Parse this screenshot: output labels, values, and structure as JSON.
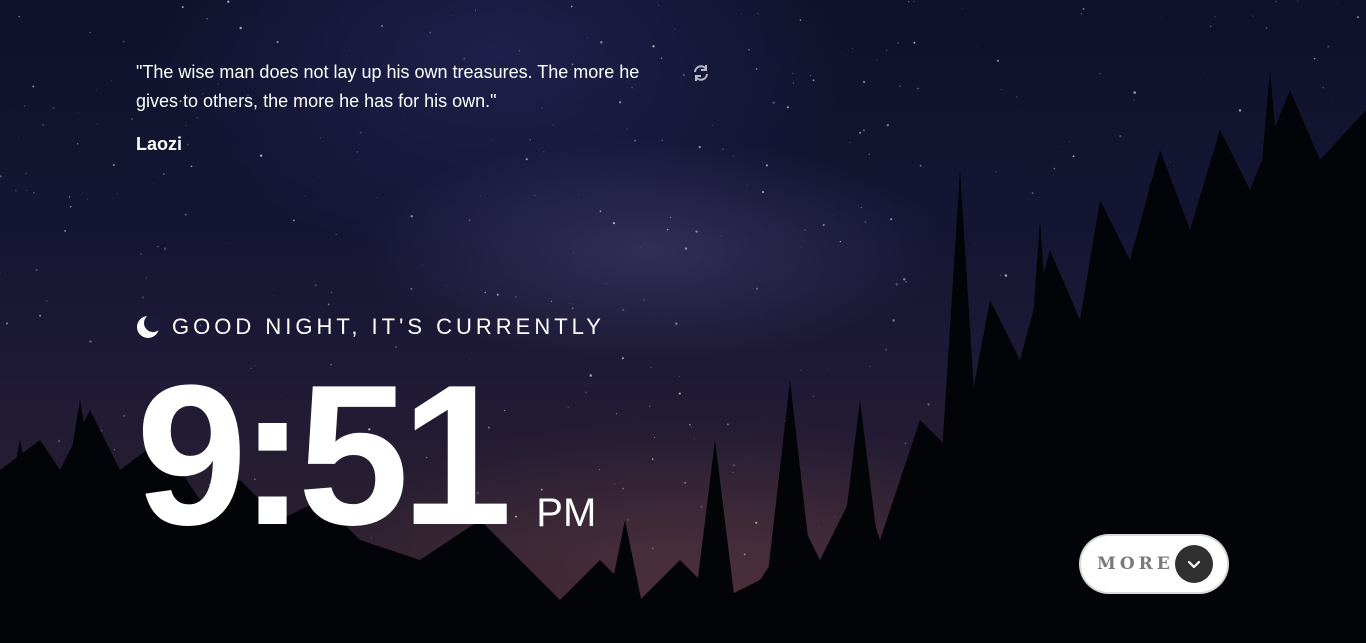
{
  "quote": {
    "text": "\"The wise man does not lay up his own treasures. The more he gives to others, the more he has for his own.\"",
    "author": "Laozi",
    "refresh_icon": "refresh-icon"
  },
  "greeting": {
    "icon": "moon-icon",
    "text": "GOOD NIGHT, IT'S CURRENTLY"
  },
  "clock": {
    "time": "9:51",
    "period": "PM"
  },
  "more_button": {
    "label": "MORE",
    "icon": "chevron-down-icon"
  },
  "colors": {
    "text": "#ffffff",
    "button_bg": "#ffffff",
    "button_label": "#7a7a7a",
    "button_circle": "#303030"
  }
}
